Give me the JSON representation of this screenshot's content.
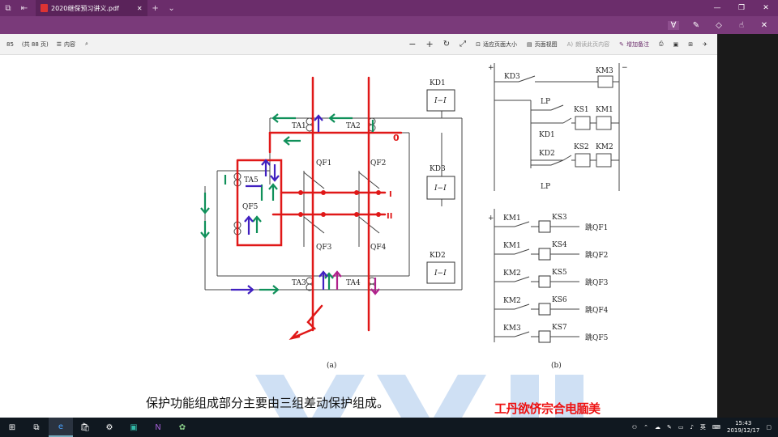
{
  "window": {
    "tab_title": "2020继保预习讲义.pdf",
    "new_tab": "+",
    "tab_menu": "⌄"
  },
  "reader_toolbar": {
    "page_number": "85",
    "page_total": "(共 88 页)",
    "contents_label": "内容",
    "zoom_out": "−",
    "zoom_in": "+",
    "fit_page_label": "适应页面大小",
    "page_view_label": "页面视图",
    "read_aloud_label": "朗读此页内容",
    "add_note_label": "增加备注"
  },
  "document": {
    "caption": "保护功能组成部分主要由三组差动保护组成。",
    "figure_a_label": "(a)",
    "figure_b_label": "(b)",
    "labels_a": {
      "KD1": "KD1",
      "KD3": "KD3",
      "KD2": "KD2",
      "TA1": "TA1",
      "TA2": "TA2",
      "TA3": "TA3",
      "TA4": "TA4",
      "TA5": "TA5",
      "QF1": "QF1",
      "QF2": "QF2",
      "QF3": "QF3",
      "QF4": "QF4",
      "QF5": "QF5",
      "relay": "I−I",
      "bus_I": "I",
      "bus_II": "II",
      "handwritten_0": "0"
    },
    "labels_b": {
      "KD3": "KD3",
      "KM3": "KM3",
      "LP": "LP",
      "KD1": "KD1",
      "KS1": "KS1",
      "KM1": "KM1",
      "KD2": "KD2",
      "KS2": "KS2",
      "KM2": "KM2",
      "rows": [
        {
          "km": "KM1",
          "ks": "KS3",
          "trip": "跳QF1"
        },
        {
          "km": "KM1",
          "ks": "KS4",
          "trip": "跳QF2"
        },
        {
          "km": "KM2",
          "ks": "KS5",
          "trip": "跳QF3"
        },
        {
          "km": "KM2",
          "ks": "KS6",
          "trip": "跳QF4"
        },
        {
          "km": "KM3",
          "ks": "KS7",
          "trip": "跳QF5"
        }
      ],
      "plus": "+",
      "minus": "−"
    }
  },
  "watermark": "工丹欲侪宗合电腼美",
  "taskbar": {
    "ime": "英",
    "time": "15:43",
    "date": "2019/12/17"
  },
  "colors": {
    "titlebar": "#6b2d6b",
    "ink_red": "#e01818",
    "ink_green": "#10905a",
    "ink_purple": "#4020c0",
    "ink_magenta": "#b0208a"
  }
}
